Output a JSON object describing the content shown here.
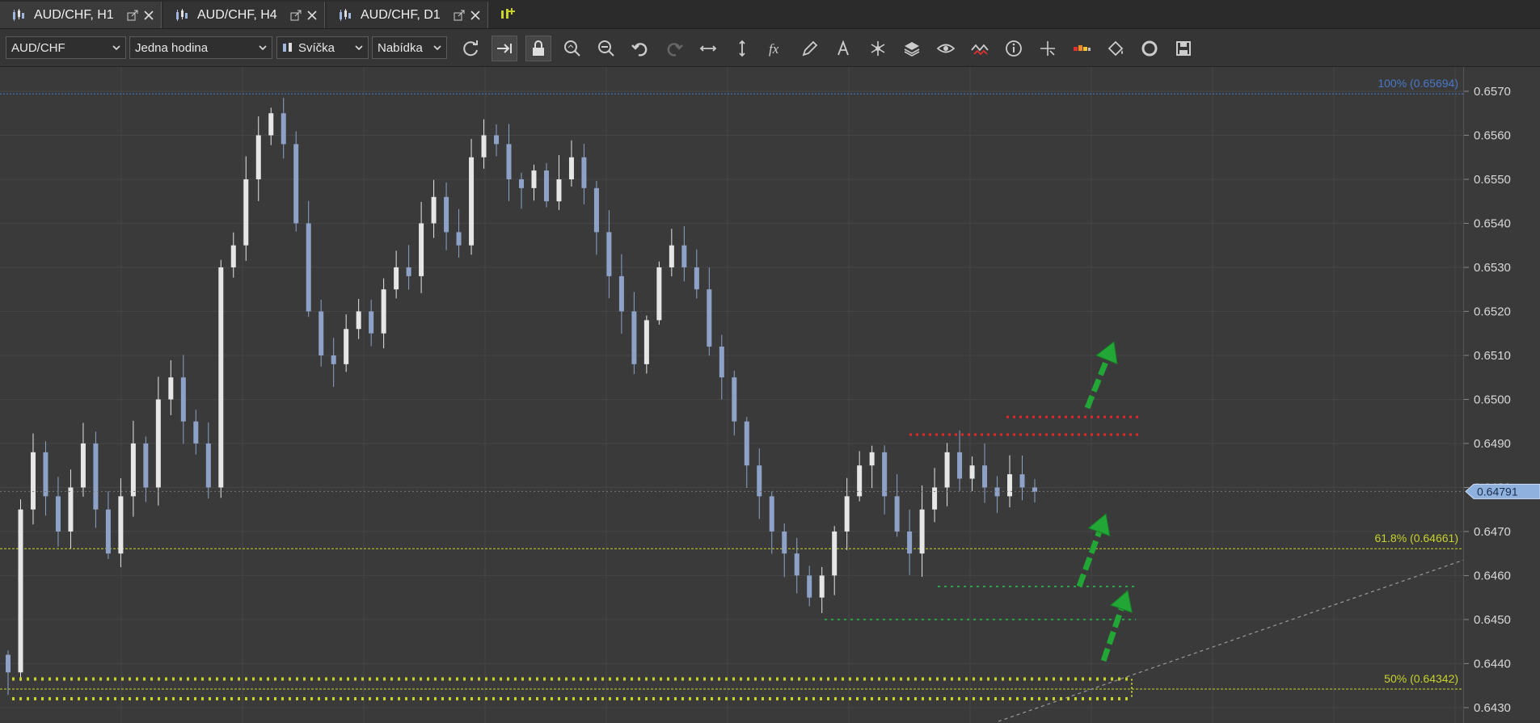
{
  "tabs": [
    {
      "label": "AUD/CHF, H1",
      "active": true
    },
    {
      "label": "AUD/CHF, H4",
      "active": false
    },
    {
      "label": "AUD/CHF, D1",
      "active": false
    }
  ],
  "toolbar": {
    "symbol": "AUD/CHF",
    "timeframe": "Jedna hodina",
    "chart_type": "Svíčka",
    "price_type": "Nabídka",
    "tools": [
      "refresh-icon",
      "autoscroll-icon",
      "lock-icon",
      "zoom-in-icon",
      "zoom-out-icon",
      "undo-icon",
      "redo-icon",
      "horizontal-scale-icon",
      "vertical-scale-icon",
      "indicator-fx-icon",
      "pencil-icon",
      "text-icon",
      "objects-icon",
      "layers-icon",
      "eye-icon",
      "signal-icon",
      "info-icon",
      "crosshair-icon",
      "heatmap-icon",
      "paint-bucket-icon",
      "settings-ring-icon",
      "save-icon"
    ]
  },
  "colors": {
    "bull": "#e6e6e6",
    "bear": "#8ea2c8",
    "fib": "#c8d22a",
    "resistance": "#e02a2a",
    "support": "#2aa64a",
    "arrow": "#22a636",
    "price_tag": "#8fb1dd",
    "fib100": "#4a78c8"
  },
  "chart_data": {
    "type": "candlestick",
    "symbol": "AUD/CHF",
    "timeframe": "H1",
    "ylim": [
      0.64265,
      0.65755
    ],
    "y_ticks": [
      "0.6570",
      "0.6560",
      "0.6550",
      "0.6540",
      "0.6530",
      "0.6520",
      "0.6510",
      "0.6500",
      "0.6490",
      "0.6480",
      "0.6470",
      "0.6460",
      "0.6450",
      "0.6440",
      "0.6430"
    ],
    "current_price": "0.64791",
    "fib_levels": [
      {
        "label": "100% (0.65694)",
        "value": 0.65694
      },
      {
        "label": "61.8% (0.64661)",
        "value": 0.64661
      },
      {
        "label": "50% (0.64342)",
        "value": 0.64342
      }
    ],
    "resistance_levels": [
      0.6496,
      0.6492
    ],
    "support_levels": [
      0.64575,
      0.645
    ],
    "fib_zone_levels": [
      0.64365,
      0.6432
    ],
    "close_path": [
      0.6438,
      0.6475,
      0.6488,
      0.6478,
      0.647,
      0.648,
      0.649,
      0.6475,
      0.6465,
      0.6478,
      0.649,
      0.648,
      0.65,
      0.6505,
      0.6495,
      0.649,
      0.648,
      0.653,
      0.6535,
      0.655,
      0.656,
      0.6565,
      0.6558,
      0.654,
      0.652,
      0.651,
      0.6508,
      0.6516,
      0.652,
      0.6515,
      0.6525,
      0.653,
      0.6528,
      0.654,
      0.6546,
      0.6538,
      0.6535,
      0.6555,
      0.656,
      0.6558,
      0.655,
      0.6548,
      0.6552,
      0.6545,
      0.655,
      0.6555,
      0.6548,
      0.6538,
      0.6528,
      0.652,
      0.6508,
      0.6518,
      0.653,
      0.6535,
      0.653,
      0.6525,
      0.6512,
      0.6505,
      0.6495,
      0.6485,
      0.6478,
      0.647,
      0.6465,
      0.646,
      0.6455,
      0.646,
      0.647,
      0.6478,
      0.6485,
      0.6488,
      0.6478,
      0.647,
      0.6465,
      0.6475,
      0.648,
      0.6488,
      0.6482,
      0.6485,
      0.648,
      0.6478,
      0.6483,
      0.648,
      0.6479
    ]
  }
}
